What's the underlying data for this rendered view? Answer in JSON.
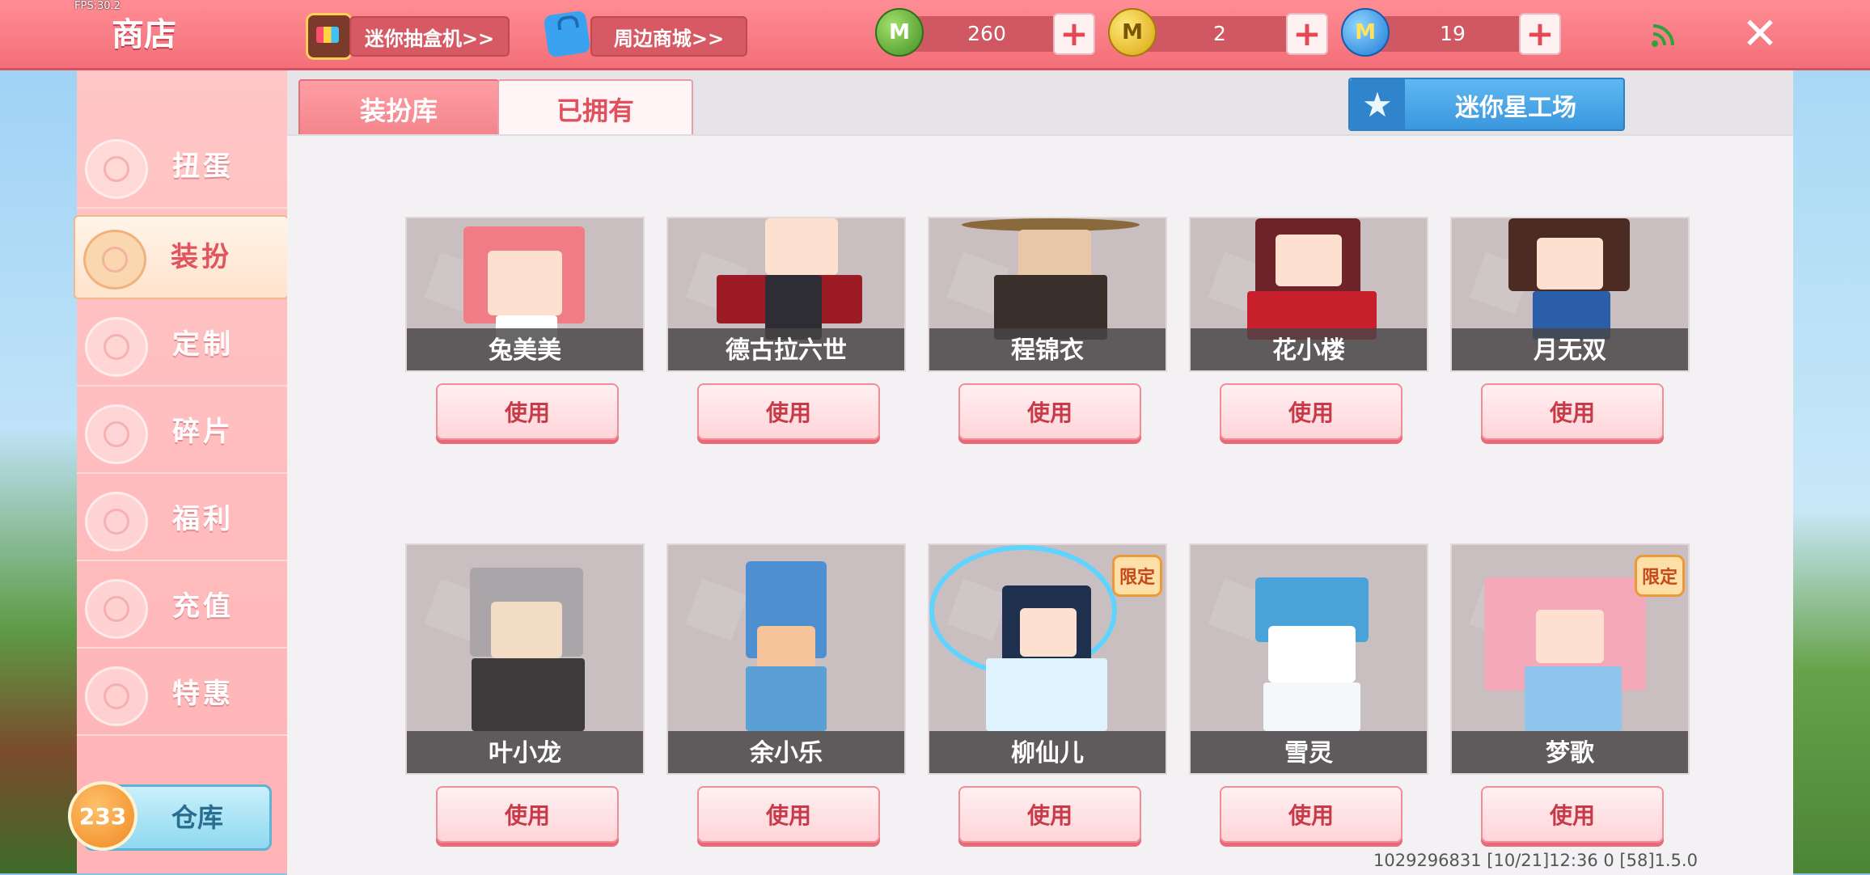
{
  "fps": "FPS:30.2",
  "header": {
    "title": "商店",
    "links": [
      {
        "label": "迷你抽盒机>>",
        "icon": "blind-box-icon"
      },
      {
        "label": "周边商城>>",
        "icon": "shopping-bag-icon"
      }
    ],
    "currencies": [
      {
        "icon": "green-mini-bean-icon",
        "value": "260",
        "color": "#4fa62f"
      },
      {
        "icon": "gold-coin-icon",
        "value": "2",
        "color": "#e6b421"
      },
      {
        "icon": "blue-mini-coin-icon",
        "value": "19",
        "color": "#2a8ae0"
      }
    ],
    "plus_glyph": "+",
    "close_glyph": "✕"
  },
  "sidebar": {
    "items": [
      {
        "label": "扭蛋",
        "icon": "capsule-icon",
        "active": false
      },
      {
        "label": "装扮",
        "icon": "tshirt-icon",
        "active": true
      },
      {
        "label": "定制",
        "icon": "pencil-icon",
        "active": false
      },
      {
        "label": "碎片",
        "icon": "fragment-icon",
        "active": false
      },
      {
        "label": "福利",
        "icon": "gift-icon",
        "active": false
      },
      {
        "label": "充值",
        "icon": "coin-stack-icon",
        "active": false
      },
      {
        "label": "特惠",
        "icon": "discount-box-icon",
        "active": false
      }
    ],
    "warehouse": {
      "label": "仓库",
      "count": "233"
    }
  },
  "tabs": {
    "active": "装扮库",
    "inactive": "已拥有"
  },
  "workshop": {
    "label": "迷你星工场",
    "icon": "star-icon"
  },
  "skins": {
    "use_label": "使用",
    "limited_label": "限定",
    "items": [
      {
        "name": "兔美美",
        "limited": false
      },
      {
        "name": "德古拉六世",
        "limited": false
      },
      {
        "name": "程锦衣",
        "limited": false
      },
      {
        "name": "花小楼",
        "limited": false
      },
      {
        "name": "月无双",
        "limited": false
      },
      {
        "name": "叶小龙",
        "limited": false
      },
      {
        "name": "余小乐",
        "limited": false
      },
      {
        "name": "柳仙儿",
        "limited": true
      },
      {
        "name": "雪灵",
        "limited": false
      },
      {
        "name": "梦歌",
        "limited": true
      }
    ]
  },
  "footer": {
    "info": "1029296831  [10/21]12:36 0   [58]1.5.0"
  },
  "colors": {
    "topbar": "#f36f79",
    "sidebar": "#ffb3b6",
    "accent_red": "#e0505d",
    "workshop_blue": "#3b97de"
  }
}
